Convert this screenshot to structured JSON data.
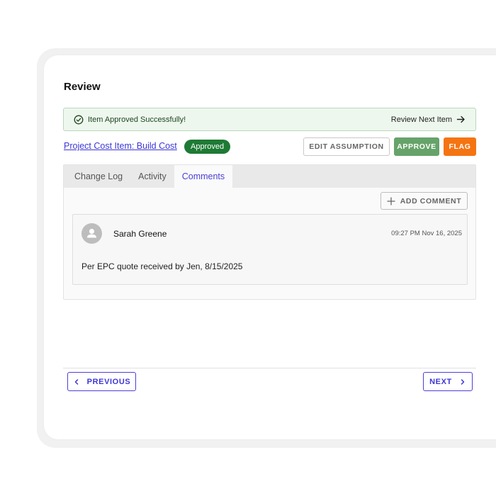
{
  "page": {
    "title": "Review"
  },
  "alert": {
    "message": "Item Approved Successfully!",
    "next_label": "Review Next Item",
    "icon": "check-circle-icon"
  },
  "item": {
    "link_label": "Project Cost Item: Build Cost",
    "status": "Approved"
  },
  "actions": {
    "edit_label": "EDIT ASSUMPTION",
    "approve_label": "APPROVE",
    "flag_label": "FLAG"
  },
  "tabs": [
    {
      "label": "Change Log",
      "active": false
    },
    {
      "label": "Activity",
      "active": false
    },
    {
      "label": "Comments",
      "active": true
    }
  ],
  "comments": {
    "add_label": "ADD COMMENT",
    "items": [
      {
        "author": "Sarah Greene",
        "time": "09:27 PM Nov 16, 2025",
        "text": "Per EPC quote received by Jen, 8/15/2025"
      }
    ]
  },
  "footer": {
    "previous_label": "PREVIOUS",
    "next_label": "NEXT"
  },
  "colors": {
    "accent": "#3d36d6",
    "success": "#1d7a34",
    "approve": "#66a36a",
    "flag": "#f57412"
  }
}
